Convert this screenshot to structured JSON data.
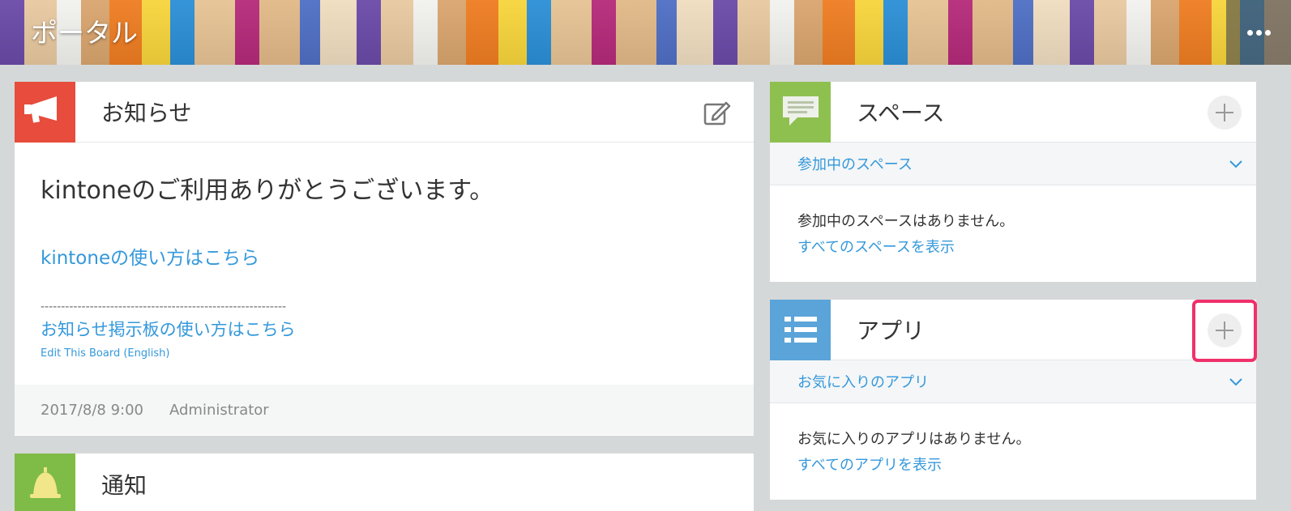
{
  "header": {
    "title": "ポータル",
    "menu_icon": "more-horizontal-icon"
  },
  "notice": {
    "title": "お知らせ",
    "icon": "megaphone-icon",
    "edit_icon": "edit-icon",
    "lead": "kintoneのご利用ありがとうございます。",
    "link1": "kintoneの使い方はこちら",
    "divider": "------------------------------------------------------------",
    "link2": "お知らせ掲示板の使い方はこちら",
    "link3": "Edit This Board (English)",
    "date": "2017/8/8 9:00",
    "author": "Administrator"
  },
  "notify": {
    "title": "通知",
    "icon": "bell-icon"
  },
  "space": {
    "title": "スペース",
    "icon": "speech-bubble-icon",
    "add_icon": "plus-icon",
    "sub_label": "参加中のスペース",
    "empty": "参加中のスペースはありません。",
    "link": "すべてのスペースを表示"
  },
  "app": {
    "title": "アプリ",
    "icon": "list-icon",
    "add_icon": "plus-icon",
    "sub_label": "お気に入りのアプリ",
    "empty": "お気に入りのアプリはありません。",
    "link": "すべてのアプリを表示"
  },
  "colors": {
    "link": "#3498db",
    "notice_accent": "#e74c3c",
    "notify_accent": "#7fbb47",
    "space_accent": "#8ec050",
    "app_accent": "#5ba4d9",
    "highlight": "#f0306a"
  }
}
